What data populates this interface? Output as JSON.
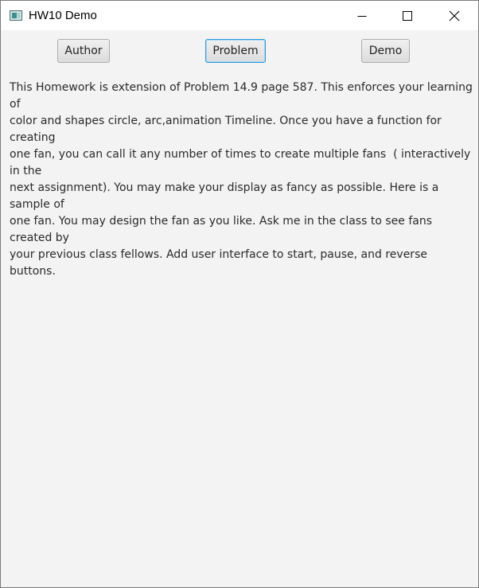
{
  "window": {
    "title": "HW10 Demo"
  },
  "toolbar": {
    "author_label": "Author",
    "problem_label": "Problem",
    "demo_label": "Demo",
    "focused_button": "Problem"
  },
  "content": {
    "lines": [
      "This Homework is extension of Problem 14.9 page 587. This enforces your learning of",
      "color and shapes circle, arc,animation Timeline. Once you have a function for creating",
      "one fan, you can call it any number of times to create multiple fans  ( interactively in the",
      "next assignment). You may make your display as fancy as possible. Here is a sample of",
      "one fan. You may design the fan as you like. Ask me in the class to see fans created by",
      "your previous class fellows. Add user interface to start, pause, and reverse buttons."
    ]
  },
  "icons": {
    "app": "java-app-icon",
    "minimize": "minimize-icon",
    "maximize": "maximize-icon",
    "close": "close-icon"
  },
  "colors": {
    "window_background": "#f3f3f3",
    "titlebar_background": "#ffffff",
    "focus_border": "#2d97d9",
    "text": "#2a2a2a"
  }
}
